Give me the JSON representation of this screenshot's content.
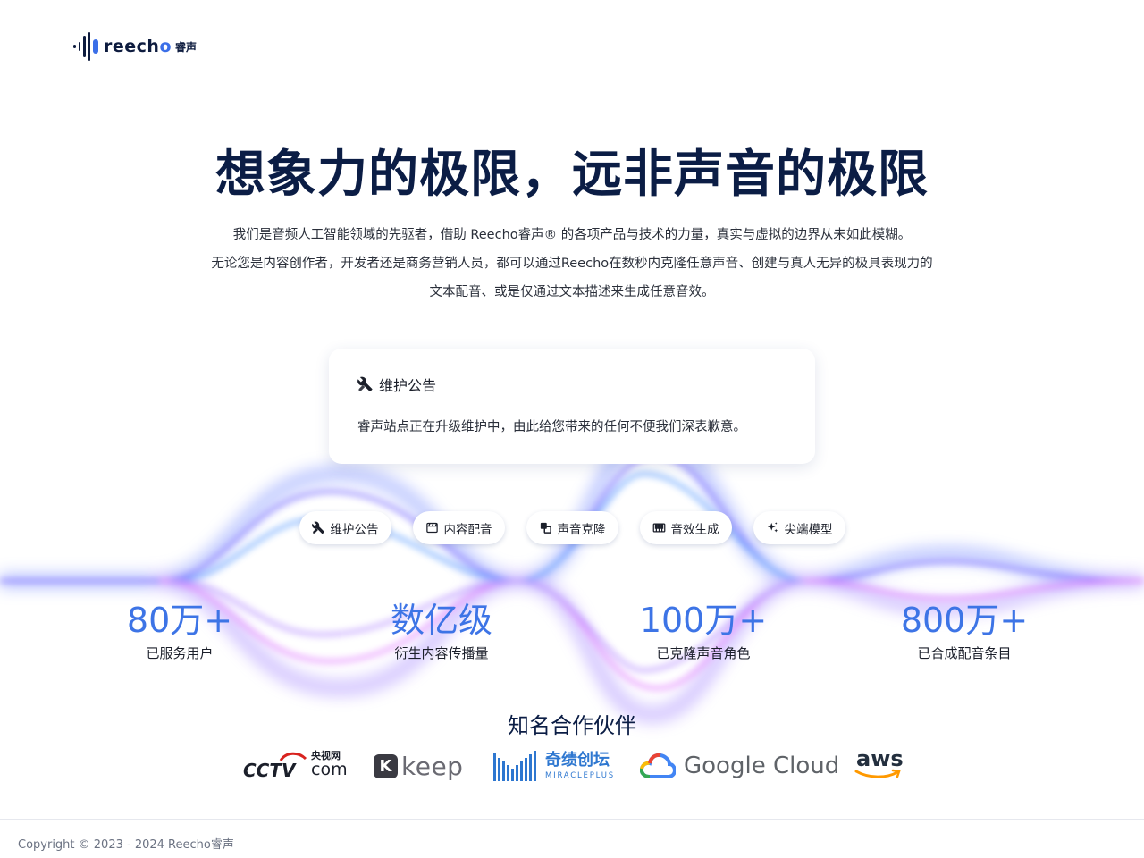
{
  "logo": {
    "text_pre": "reech",
    "text_o": "o",
    "cn": "睿声"
  },
  "hero": {
    "title": "想象力的极限，远非声音的极限",
    "desc_line1": "我们是音频人工智能领域的先驱者，借助 Reecho睿声® 的各项产品与技术的力量，真实与虚拟的边界从未如此模糊。",
    "desc_line2": "无论您是内容创作者，开发者还是商务营销人员，都可以通过Reecho在数秒内克隆任意声音、创建与真人无异的极具表现力的",
    "desc_line3": "文本配音、或是仅通过文本描述来生成任意音效。"
  },
  "notice": {
    "icon": "tools-icon",
    "title": "维护公告",
    "body": "睿声站点正在升级维护中，由此给您带来的任何不便我们深表歉意。"
  },
  "tabs": [
    {
      "label": "维护公告",
      "icon": "tools-icon"
    },
    {
      "label": "内容配音",
      "icon": "film-icon"
    },
    {
      "label": "声音克隆",
      "icon": "clone-icon"
    },
    {
      "label": "音效生成",
      "icon": "piano-icon"
    },
    {
      "label": "尖端模型",
      "icon": "sparkle-icon"
    }
  ],
  "stats": [
    {
      "value": "80万+",
      "label": "已服务用户"
    },
    {
      "value": "数亿级",
      "label": "衍生内容传播量"
    },
    {
      "value": "100万+",
      "label": "已克隆声音角色"
    },
    {
      "value": "800万+",
      "label": "已合成配音条目"
    }
  ],
  "partners": {
    "title": "知名合作伙伴",
    "cctv": {
      "logo": "CCTV",
      "cn": "央视网",
      "com": "com"
    },
    "keep": {
      "k": "K",
      "text": "keep"
    },
    "miracle": {
      "cn": "奇绩创坛",
      "en": "MIRACLEPLUS"
    },
    "google": {
      "text": "Google Cloud"
    },
    "aws": {
      "text": "aws"
    }
  },
  "footer": {
    "copyright": "Copyright © 2023 - 2024 Reecho睿声"
  },
  "colors": {
    "accent": "#3d74e6",
    "title": "#0b1d45",
    "wave_blue": "#5b7cff",
    "wave_pink": "#e07bff"
  }
}
